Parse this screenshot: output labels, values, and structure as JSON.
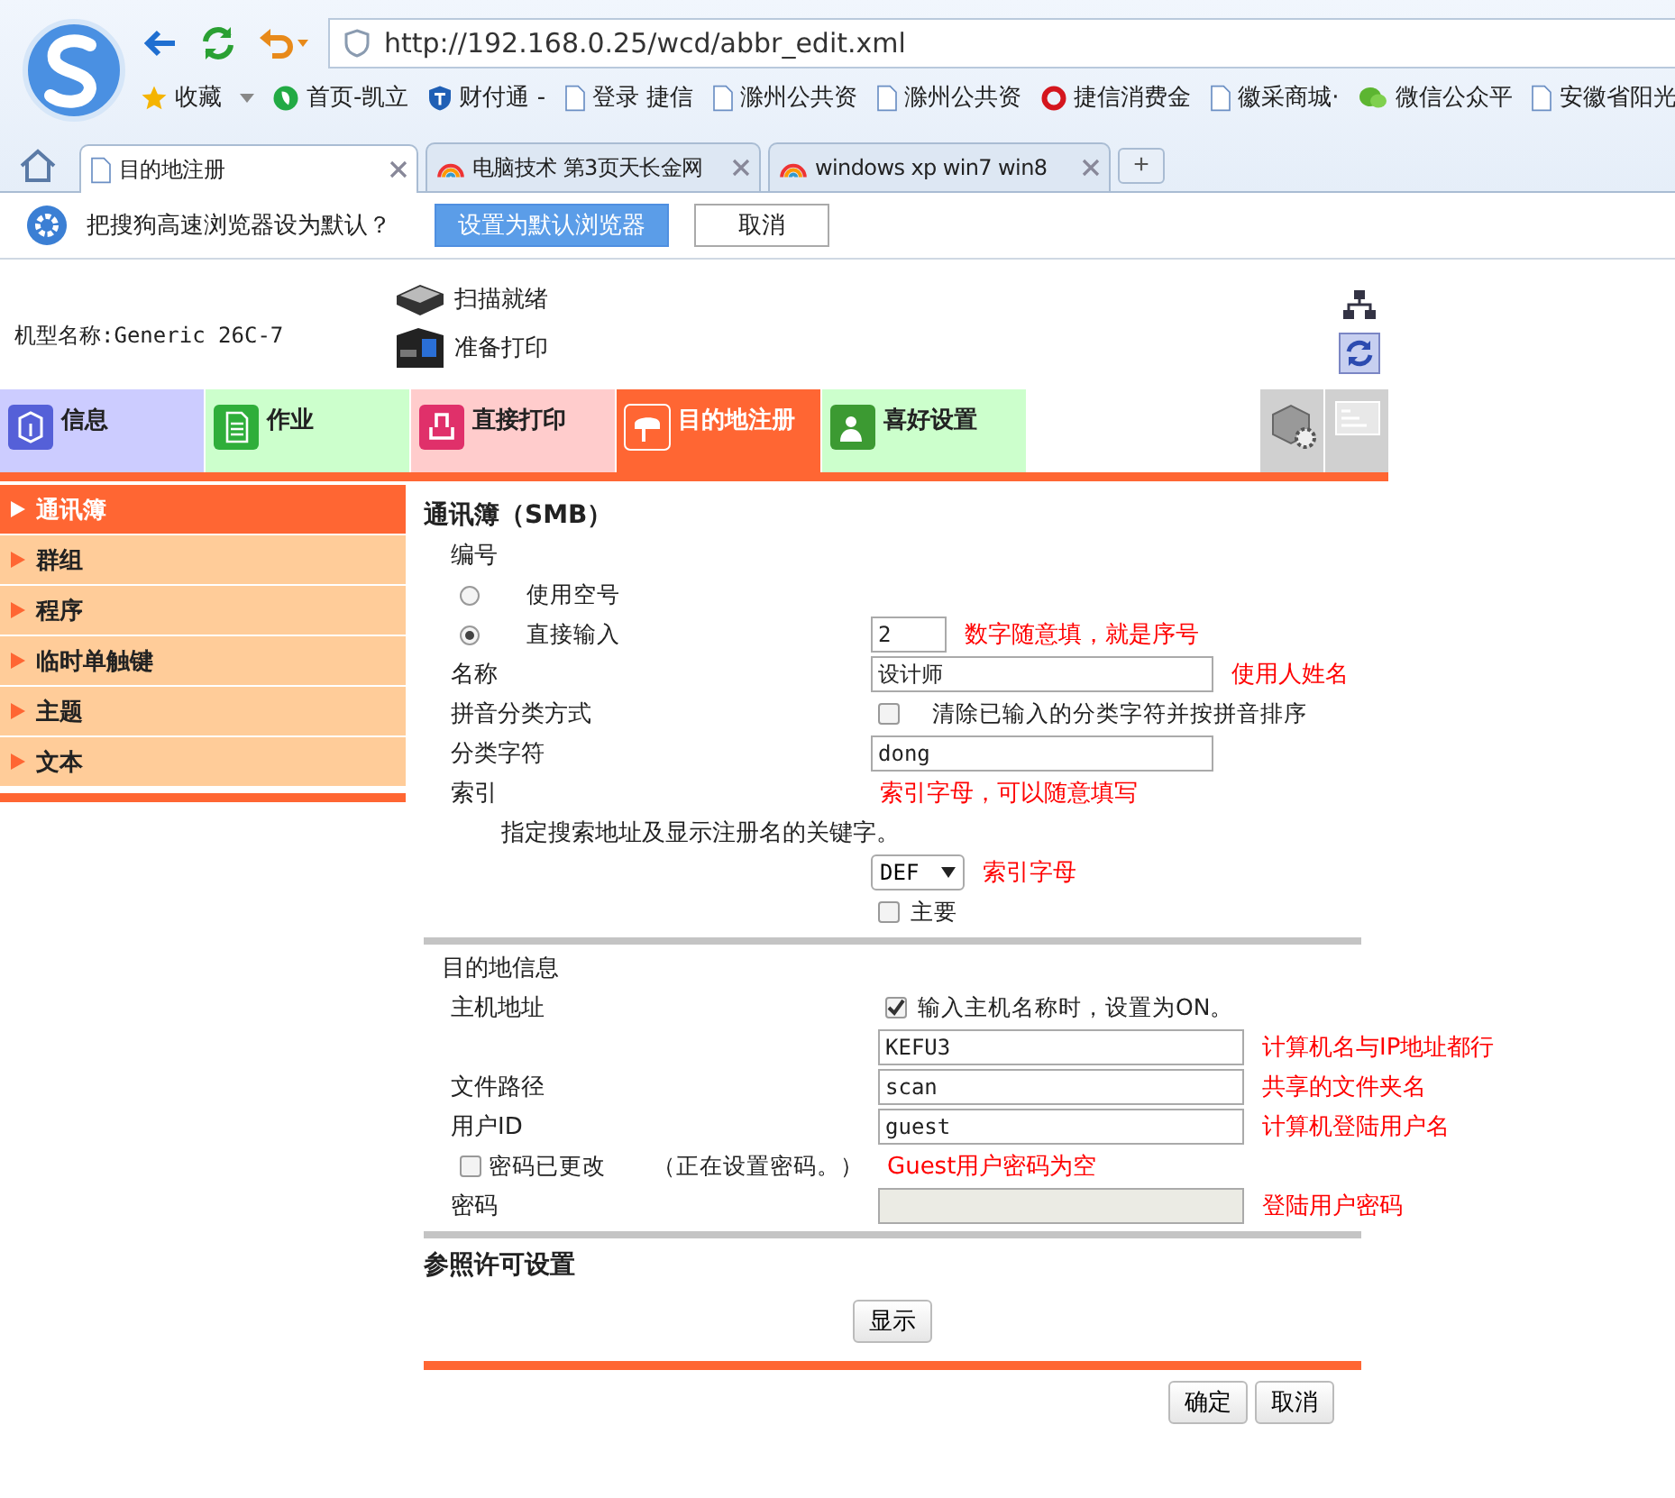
{
  "browser": {
    "address": "http://192.168.0.25/wcd/abbr_edit.xml",
    "bookmarks": [
      {
        "kind": "star",
        "label": "收藏",
        "caret": true
      },
      {
        "kind": "home",
        "label": "首页-凯立",
        "caret": false
      },
      {
        "kind": "shield",
        "label": "财付通 -",
        "caret": false
      },
      {
        "kind": "page",
        "label": "登录 捷信",
        "caret": false
      },
      {
        "kind": "page",
        "label": "滁州公共资",
        "caret": false
      },
      {
        "kind": "page",
        "label": "滁州公共资",
        "caret": false
      },
      {
        "kind": "ring",
        "label": "捷信消费金",
        "caret": false
      },
      {
        "kind": "page",
        "label": "徽采商城·",
        "caret": false
      },
      {
        "kind": "chat",
        "label": "微信公众平",
        "caret": false
      },
      {
        "kind": "page",
        "label": "安徽省阳光",
        "caret": false
      }
    ],
    "tabs": [
      {
        "kind": "page",
        "label": "目的地注册",
        "selected": true
      },
      {
        "kind": "rainbow",
        "label": "电脑技术 第3页天长金网",
        "selected": false
      },
      {
        "kind": "rainbow",
        "label": "windows xp win7 win8",
        "selected": false
      }
    ],
    "new_tab": "+",
    "notification": {
      "text": "把搜狗高速浏览器设为默认？",
      "primary_button": "设置为默认浏览器",
      "secondary_button": "取消"
    }
  },
  "header": {
    "model": "机型名称:Generic 26C-7",
    "status": [
      {
        "kind": "scanner",
        "text": "扫描就绪"
      },
      {
        "kind": "printer",
        "text": "准备打印"
      }
    ]
  },
  "nav_tabs": [
    {
      "kind": "info",
      "label": "信息",
      "selected": false
    },
    {
      "kind": "job",
      "label": "作业",
      "selected": false
    },
    {
      "kind": "print",
      "label": "直接打印",
      "selected": false
    },
    {
      "kind": "address",
      "label": "目的地注册",
      "selected": true
    },
    {
      "kind": "favorite",
      "label": "喜好设置",
      "selected": false
    }
  ],
  "sidebar": [
    {
      "label": "通讯簿",
      "selected": true
    },
    {
      "label": "群组",
      "selected": false
    },
    {
      "label": "程序",
      "selected": false
    },
    {
      "label": "临时单触键",
      "selected": false
    },
    {
      "label": "主题",
      "selected": false
    },
    {
      "label": "文本",
      "selected": false
    }
  ],
  "form": {
    "title": "通讯簿（SMB）",
    "sections": [
      {
        "rows": [
          {
            "kind": "label",
            "label": "编号"
          },
          {
            "kind": "radio",
            "label": "使用空号",
            "selected": false
          },
          {
            "kind": "radio",
            "label": "直接输入",
            "selected": true,
            "value": "2",
            "note": "数字随意填，就是序号"
          },
          {
            "kind": "field",
            "label": "名称",
            "value": "设计师",
            "note": "使用人姓名"
          },
          {
            "kind": "check",
            "label": "拼音分类方式",
            "text": "清除已输入的分类字符并按拼音排序",
            "checked": false
          },
          {
            "kind": "field",
            "label": "分类字符",
            "value": "dong"
          },
          {
            "kind": "note",
            "label": "索引",
            "note": "索引字母，可以随意填写"
          },
          {
            "kind": "description",
            "text": "指定搜索地址及显示注册名的关键字。"
          },
          {
            "kind": "select",
            "value": "DEF",
            "note": "索引字母"
          },
          {
            "kind": "check",
            "text": "主要",
            "checked": false
          }
        ]
      },
      {
        "heading": "目的地信息",
        "rows": [
          {
            "kind": "check",
            "label": "主机地址",
            "text": "输入主机名称时，设置为ON。",
            "checked": true
          },
          {
            "kind": "field",
            "value": "KEFU3",
            "note": "计算机名与IP地址都行"
          },
          {
            "kind": "field",
            "label": "文件路径",
            "value": "scan",
            "note": "共享的文件夹名"
          },
          {
            "kind": "field",
            "label": "用户ID",
            "value": "guest",
            "note": "计算机登陆用户名"
          },
          {
            "kind": "check_left",
            "text": "密码已更改",
            "aside": "（正在设置密码。）",
            "checked": false,
            "note": "Guest用户密码为空"
          },
          {
            "kind": "field",
            "label": "密码",
            "disabled": true,
            "note": "登陆用户密码"
          }
        ]
      }
    ],
    "permission": {
      "heading": "参照许可设置",
      "button": "显示"
    },
    "actions": [
      "确定",
      "取消"
    ]
  }
}
